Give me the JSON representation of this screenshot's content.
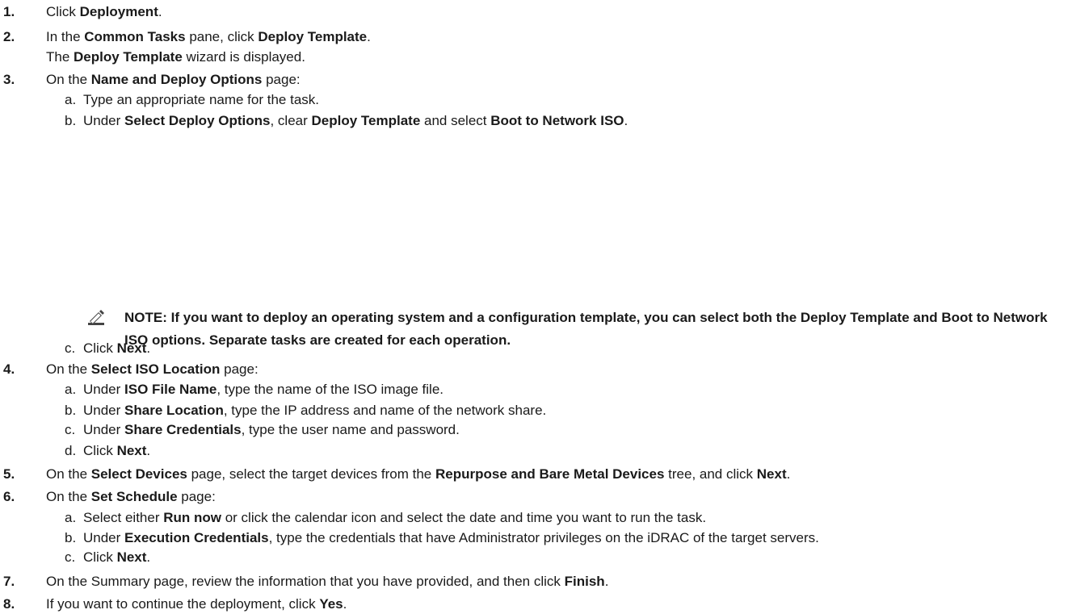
{
  "steps": [
    {
      "num": "1.",
      "parts": [
        "Click ",
        "**Deployment",
        "."
      ]
    },
    {
      "num": "2.",
      "parts": [
        "In the ",
        "**Common Tasks",
        " pane, click ",
        "**Deploy Template",
        "."
      ]
    },
    {
      "cont": [
        "The ",
        "**Deploy Template",
        " wizard is displayed."
      ]
    },
    {
      "num": "3.",
      "parts": [
        "On the ",
        "**Name and Deploy Options",
        " page:"
      ]
    },
    {
      "letter": "a.",
      "parts": [
        "Type an appropriate name for the task."
      ]
    },
    {
      "letter": "b.",
      "parts": [
        "Under ",
        "**Select Deploy Options",
        ", clear ",
        "**Deploy Template",
        " and select ",
        "**Boot to Network ISO",
        "."
      ]
    },
    {
      "letter": "c.",
      "parts": [
        "Click ",
        "**Next",
        "."
      ]
    },
    {
      "num": "4.",
      "parts": [
        "On the ",
        "**Select ISO Location",
        " page:"
      ]
    },
    {
      "letter": "a.",
      "parts": [
        "Under ",
        "**ISO File Name",
        ", type the name of the ISO image file."
      ]
    },
    {
      "letter": "b.",
      "parts": [
        "Under ",
        "**Share Location",
        ", type the IP address and name of the network share."
      ]
    },
    {
      "letter": "c.",
      "parts": [
        "Under ",
        "**Share Credentials",
        ", type the user name and password."
      ]
    },
    {
      "letter": "d.",
      "parts": [
        "Click ",
        "**Next",
        "."
      ]
    },
    {
      "num": "5.",
      "parts": [
        "On the ",
        "**Select Devices",
        " page, select the target devices from the ",
        "**Repurpose and Bare Metal Devices",
        " tree, and click ",
        "**Next",
        "."
      ]
    },
    {
      "num": "6.",
      "parts": [
        "On the ",
        "**Set Schedule",
        " page:"
      ]
    },
    {
      "letter": "a.",
      "parts": [
        "Select either ",
        "**Run now",
        " or click the calendar icon and select the date and time you want to run the task."
      ]
    },
    {
      "letter": "b.",
      "parts": [
        "Under ",
        "**Execution Credentials",
        ", type the credentials that have Administrator privileges on the iDRAC of the target servers."
      ]
    },
    {
      "letter": "c.",
      "parts": [
        "Click ",
        "**Next",
        "."
      ]
    },
    {
      "num": "7.",
      "parts": [
        "On the Summary page, review the information that you have provided, and then click ",
        "**Finish",
        "."
      ]
    },
    {
      "num": "8.",
      "parts": [
        "If you want to continue the deployment, click ",
        "**Yes",
        "."
      ]
    }
  ],
  "note": {
    "text": "NOTE: If you want to deploy an operating system and a configuration template, you can select both the Deploy Template and Boot to Network ISO options. Separate tasks are created for each operation.",
    "icon": "note-pencil-icon"
  }
}
